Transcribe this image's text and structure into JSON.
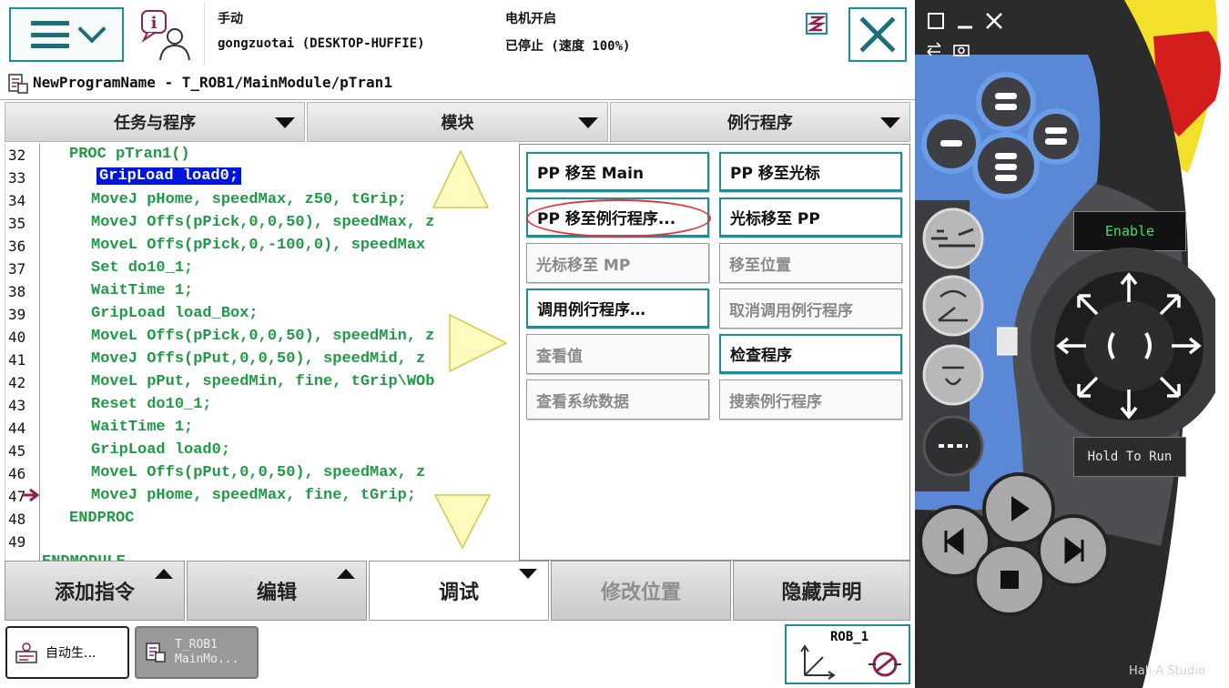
{
  "status": {
    "mode": "手动",
    "controller": "gongzuotai (DESKTOP-HUFFIE)",
    "motor": "电机开启",
    "state": "已停止 (速度 100%)"
  },
  "path": "NewProgramName - T_ROB1/MainModule/pTran1",
  "dropdowns": [
    "任务与程序",
    "模块",
    "例行程序"
  ],
  "code": {
    "line_numbers": [
      "32",
      "33",
      "34",
      "35",
      "36",
      "37",
      "38",
      "39",
      "40",
      "41",
      "42",
      "43",
      "44",
      "45",
      "46",
      "47",
      "48",
      "49"
    ],
    "lines": [
      "PROC pTran1()",
      "GripLoad load0;",
      "MoveJ pHome, speedMax, z50, tGrip;",
      "MoveJ Offs(pPick,0,0,50), speedMax, z",
      "MoveL Offs(pPick,0,-100,0), speedMax",
      "Set do10_1;",
      "WaitTime 1;",
      "GripLoad load_Box;",
      "MoveL Offs(pPick,0,0,50), speedMin, z",
      "MoveJ Offs(pPut,0,0,50), speedMid, z",
      "MoveL pPut, speedMin, fine, tGrip\\WOb",
      "Reset do10_1;",
      "WaitTime 1;",
      "GripLoad load0;",
      "MoveL Offs(pPut,0,0,50), speedMax, z",
      "MoveJ pHome, speedMax, fine, tGrip;",
      "ENDPROC",
      ""
    ],
    "cut_line": "ENDMODULE"
  },
  "popup": {
    "pp_to_main": "PP 移至 Main",
    "pp_to_cursor": "PP 移至光标",
    "pp_to_routine": "PP 移至例行程序...",
    "cursor_to_pp": "光标移至 PP",
    "cursor_to_mp": "光标移至 MP",
    "move_to_position": "移至位置",
    "call_routine": "调用例行程序…",
    "cancel_call": "取消调用例行程序",
    "view_value": "查看值",
    "check_program": "检查程序",
    "view_system_data": "查看系统数据",
    "search_routine": "搜索例行程序"
  },
  "toolbar": [
    "添加指令",
    "编辑",
    "调试",
    "修改位置",
    "隐藏声明"
  ],
  "tasks": {
    "task1": "自动生...",
    "task2_line1": "T_ROB1",
    "task2_line2": "MainMo..."
  },
  "rob_label": "ROB_1",
  "pendant": {
    "enable": "Enable",
    "hold_to_run": "Hold To Run"
  },
  "watermark": "Hall-A Studio",
  "colors": {
    "accent": "#1a8f9c",
    "code_green": "#1f9a45",
    "highlight": "#0015e0",
    "annotation_red": "#e3343a",
    "overlay_yellow": "#fff9a8",
    "pendant_blue": "#5a88d6",
    "estop_yellow": "#f2e02a",
    "estop_red": "#d61d1d"
  }
}
